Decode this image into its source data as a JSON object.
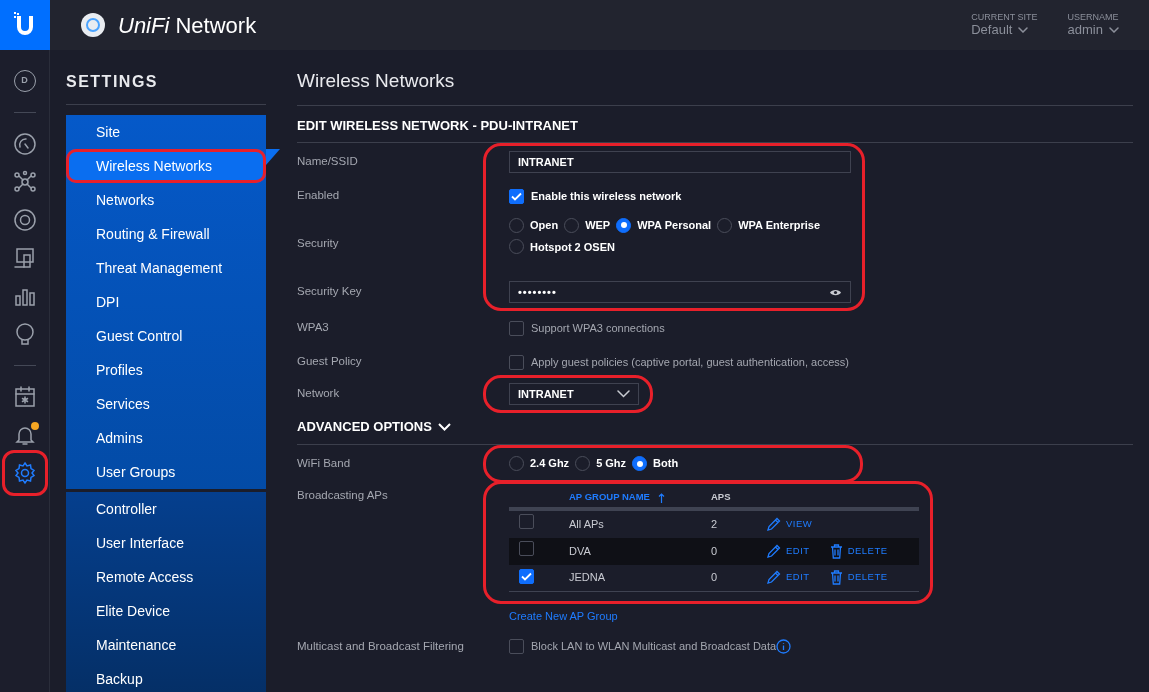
{
  "header": {
    "app_title": "*UniFi* Network",
    "site": {
      "label": "CURRENT SITE",
      "value": "Default"
    },
    "user": {
      "label": "USERNAME",
      "value": "admin"
    }
  },
  "rail": [
    {
      "kind": "letter",
      "text": "D",
      "selected": false,
      "highlighted": false,
      "badge": false
    },
    {
      "kind": "divider"
    },
    {
      "kind": "gauge",
      "selected": false,
      "highlighted": false,
      "badge": false
    },
    {
      "kind": "topology",
      "selected": false,
      "highlighted": false,
      "badge": false
    },
    {
      "kind": "device",
      "selected": false,
      "highlighted": false,
      "badge": false
    },
    {
      "kind": "clients",
      "selected": false,
      "highlighted": false,
      "badge": false
    },
    {
      "kind": "stats",
      "selected": false,
      "highlighted": false,
      "badge": false
    },
    {
      "kind": "bulb",
      "selected": false,
      "highlighted": false,
      "badge": false
    },
    {
      "kind": "divider"
    },
    {
      "kind": "calendar",
      "selected": false,
      "highlighted": false,
      "badge": false
    },
    {
      "kind": "bell",
      "selected": false,
      "highlighted": false,
      "badge": true
    },
    {
      "kind": "gear",
      "selected": true,
      "highlighted": true,
      "badge": false
    }
  ],
  "sidebar": {
    "title": "SETTINGS",
    "groups": [
      {
        "items": [
          {
            "label": "Site",
            "selected": false,
            "highlighted": false
          },
          {
            "label": "Wireless Networks",
            "selected": true,
            "highlighted": true
          },
          {
            "label": "Networks",
            "selected": false,
            "highlighted": false
          },
          {
            "label": "Routing & Firewall",
            "selected": false,
            "highlighted": false
          },
          {
            "label": "Threat Management",
            "selected": false,
            "highlighted": false
          },
          {
            "label": "DPI",
            "selected": false,
            "highlighted": false
          },
          {
            "label": "Guest Control",
            "selected": false,
            "highlighted": false
          },
          {
            "label": "Profiles",
            "selected": false,
            "highlighted": false
          },
          {
            "label": "Services",
            "selected": false,
            "highlighted": false
          },
          {
            "label": "Admins",
            "selected": false,
            "highlighted": false
          },
          {
            "label": "User Groups",
            "selected": false,
            "highlighted": false
          }
        ]
      },
      {
        "items": [
          {
            "label": "Controller",
            "selected": false,
            "highlighted": false
          },
          {
            "label": "User Interface",
            "selected": false,
            "highlighted": false
          },
          {
            "label": "Remote Access",
            "selected": false,
            "highlighted": false
          },
          {
            "label": "Elite Device",
            "selected": false,
            "highlighted": false
          },
          {
            "label": "Maintenance",
            "selected": false,
            "highlighted": false
          },
          {
            "label": "Backup",
            "selected": false,
            "highlighted": false
          }
        ]
      }
    ]
  },
  "page_title": "Wireless Networks",
  "sections": [
    {
      "title": "EDIT WIRELESS NETWORK - PDU-INTRANET",
      "collapsible": false,
      "groups": [
        {
          "highlighted": true,
          "rows": [
            {
              "label": "Name/SSID",
              "kind": "text",
              "value": "INTRANET"
            },
            {
              "label": "Enabled",
              "kind": "checkbox",
              "checked": true,
              "text": "Enable this wireless network"
            },
            {
              "label": "Security",
              "kind": "radios",
              "options": [
                {
                  "label": "Open",
                  "selected": false
                },
                {
                  "label": "WEP",
                  "selected": false
                },
                {
                  "label": "WPA Personal",
                  "selected": true
                },
                {
                  "label": "WPA Enterprise",
                  "selected": false
                },
                {
                  "label": "Hotspot 2 OSEN",
                  "selected": false
                }
              ]
            },
            {
              "label": "Security Key",
              "kind": "password",
              "value": "••••••••"
            }
          ]
        },
        {
          "highlighted": false,
          "rows": [
            {
              "label": "WPA3",
              "kind": "checkbox",
              "checked": false,
              "text": "Support WPA3 connections"
            },
            {
              "label": "Guest Policy",
              "kind": "checkbox",
              "checked": false,
              "text": "Apply guest policies (captive portal, guest authentication, access)"
            }
          ]
        },
        {
          "highlighted": true,
          "rows": [
            {
              "label": "Network",
              "kind": "select",
              "value": "INTRANET"
            }
          ]
        }
      ]
    },
    {
      "title": "ADVANCED OPTIONS",
      "collapsible": true,
      "groups": [
        {
          "highlighted": true,
          "rows": [
            {
              "label": "WiFi Band",
              "kind": "radios",
              "options": [
                {
                  "label": "2.4 Ghz",
                  "selected": false
                },
                {
                  "label": "5 Ghz",
                  "selected": false
                },
                {
                  "label": "Both",
                  "selected": true
                }
              ]
            }
          ]
        },
        {
          "highlighted": true,
          "rows": [
            {
              "label": "Broadcasting APs",
              "kind": "table",
              "columns": [
                {
                  "label": "AP GROUP NAME",
                  "sorted": true
                },
                {
                  "label": "APS",
                  "sorted": false
                }
              ],
              "table_rows": [
                {
                  "checked": false,
                  "hover": false,
                  "name": "All APs",
                  "aps": "2",
                  "actions": [
                    {
                      "kind": "pencil",
                      "label": "VIEW"
                    }
                  ]
                },
                {
                  "checked": false,
                  "hover": true,
                  "name": "DVA",
                  "aps": "0",
                  "actions": [
                    {
                      "kind": "pencil",
                      "label": "EDIT"
                    },
                    {
                      "kind": "trash",
                      "label": "DELETE"
                    }
                  ]
                },
                {
                  "checked": true,
                  "hover": false,
                  "name": "JEDNA",
                  "aps": "0",
                  "actions": [
                    {
                      "kind": "pencil",
                      "label": "EDIT"
                    },
                    {
                      "kind": "trash",
                      "label": "DELETE"
                    }
                  ]
                }
              ]
            }
          ]
        },
        {
          "highlighted": false,
          "rows": [
            {
              "label": "",
              "kind": "link",
              "text": "Create New AP Group"
            },
            {
              "label": "Multicast and Broadcast Filtering",
              "kind": "checkbox",
              "checked": false,
              "text": "Block LAN to WLAN Multicast and Broadcast Data",
              "info": true
            }
          ]
        }
      ]
    }
  ]
}
